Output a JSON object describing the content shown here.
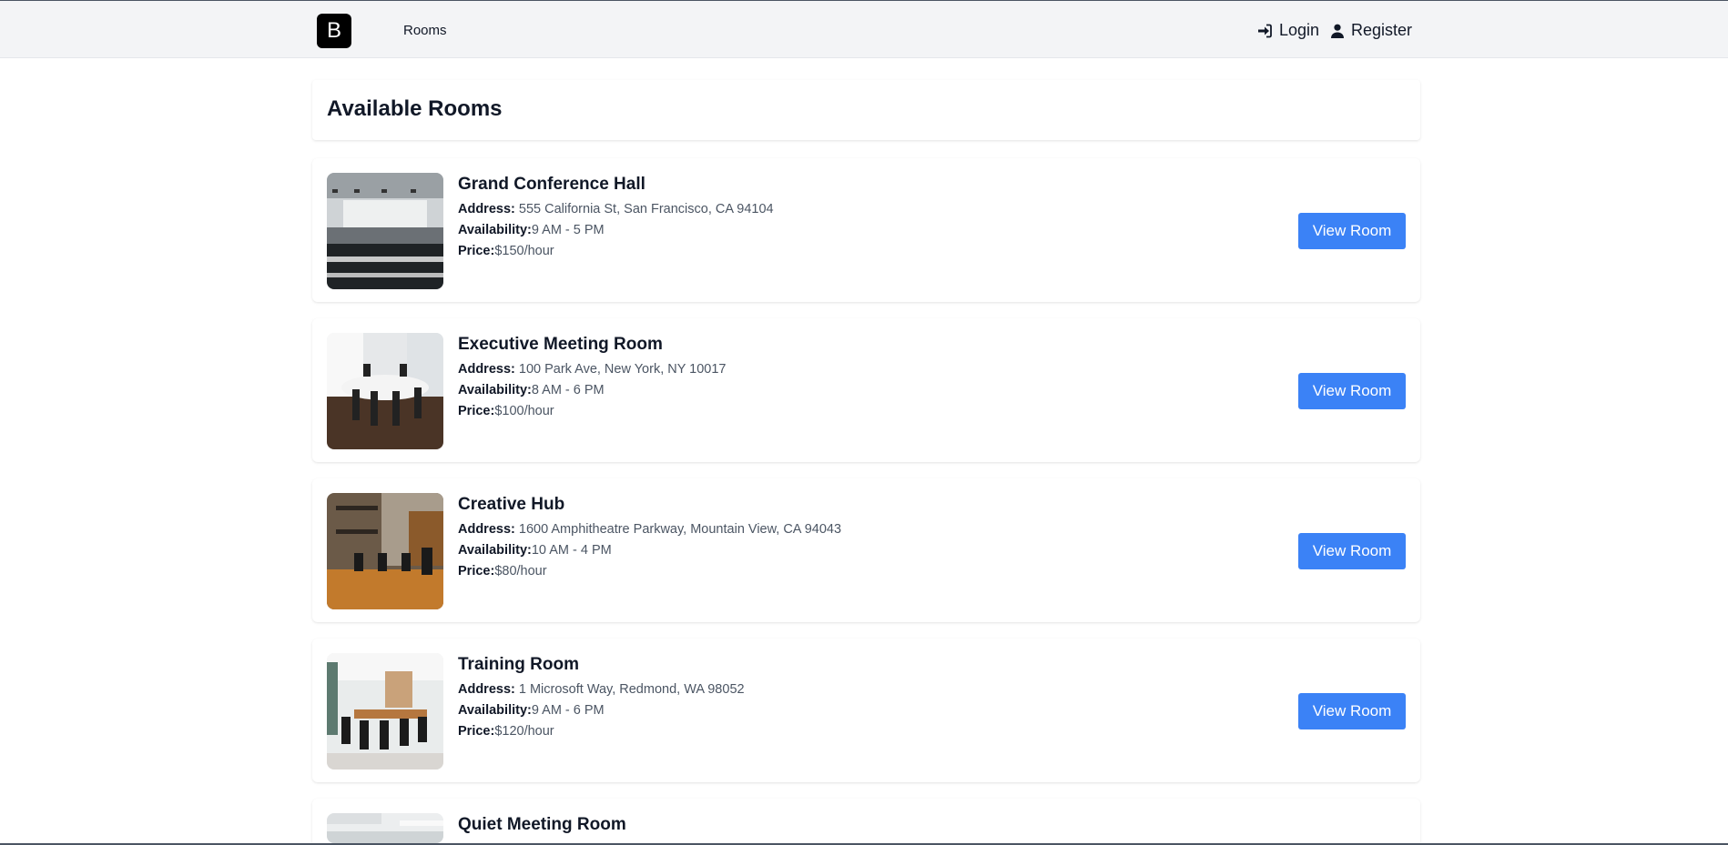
{
  "nav": {
    "logo_letter": "B",
    "rooms_link": "Rooms",
    "login_label": "Login",
    "register_label": "Register"
  },
  "page": {
    "title": "Available Rooms"
  },
  "labels": {
    "address": "Address:",
    "availability": "Availability:",
    "price": "Price:",
    "view_button": "View Room"
  },
  "rooms": [
    {
      "name": "Grand Conference Hall",
      "address": "555 California St, San Francisco, CA 94104",
      "availability": "9 AM - 5 PM",
      "price": "$150/hour"
    },
    {
      "name": "Executive Meeting Room",
      "address": "100 Park Ave, New York, NY 10017",
      "availability": "8 AM - 6 PM",
      "price": "$100/hour"
    },
    {
      "name": "Creative Hub",
      "address": "1600 Amphitheatre Parkway, Mountain View, CA 94043",
      "availability": "10 AM - 4 PM",
      "price": "$80/hour"
    },
    {
      "name": "Training Room",
      "address": "1 Microsoft Way, Redmond, WA 98052",
      "availability": "9 AM - 6 PM",
      "price": "$120/hour"
    },
    {
      "name": "Quiet Meeting Room"
    }
  ],
  "colors": {
    "primary_button": "#3b82f6",
    "topbar_bg": "#f3f4f6"
  }
}
